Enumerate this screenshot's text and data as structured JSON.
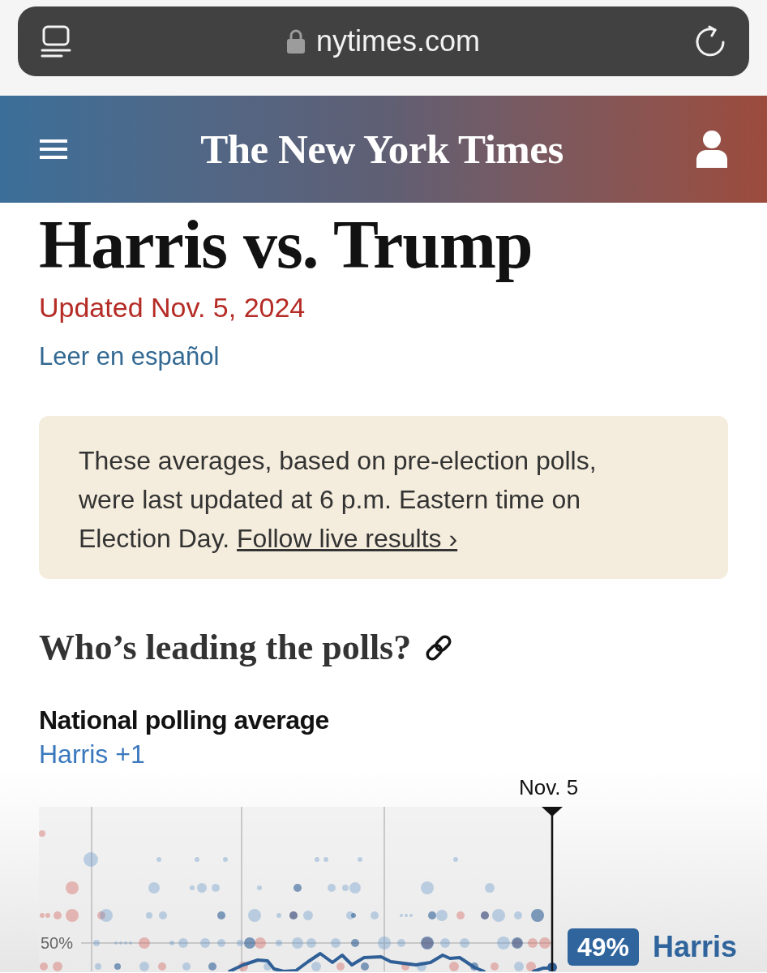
{
  "browser": {
    "url": "nytimes.com"
  },
  "header": {
    "logo": "The New York Times"
  },
  "article": {
    "title": "Harris vs. Trump",
    "updated": "Updated Nov. 5, 2024",
    "language_link": "Leer en español"
  },
  "notice": {
    "text": "These averages, based on pre-election polls, were last updated at 6 p.m. Eastern time on Election Day.",
    "link": "Follow live results ›"
  },
  "section": {
    "heading": "Who’s leading the polls?"
  },
  "chart": {
    "title": "National polling average",
    "leader": "Harris +1",
    "date_marker": "Nov. 5",
    "y_label": "50%",
    "value_badge": "49%",
    "candidate": "Harris"
  }
}
